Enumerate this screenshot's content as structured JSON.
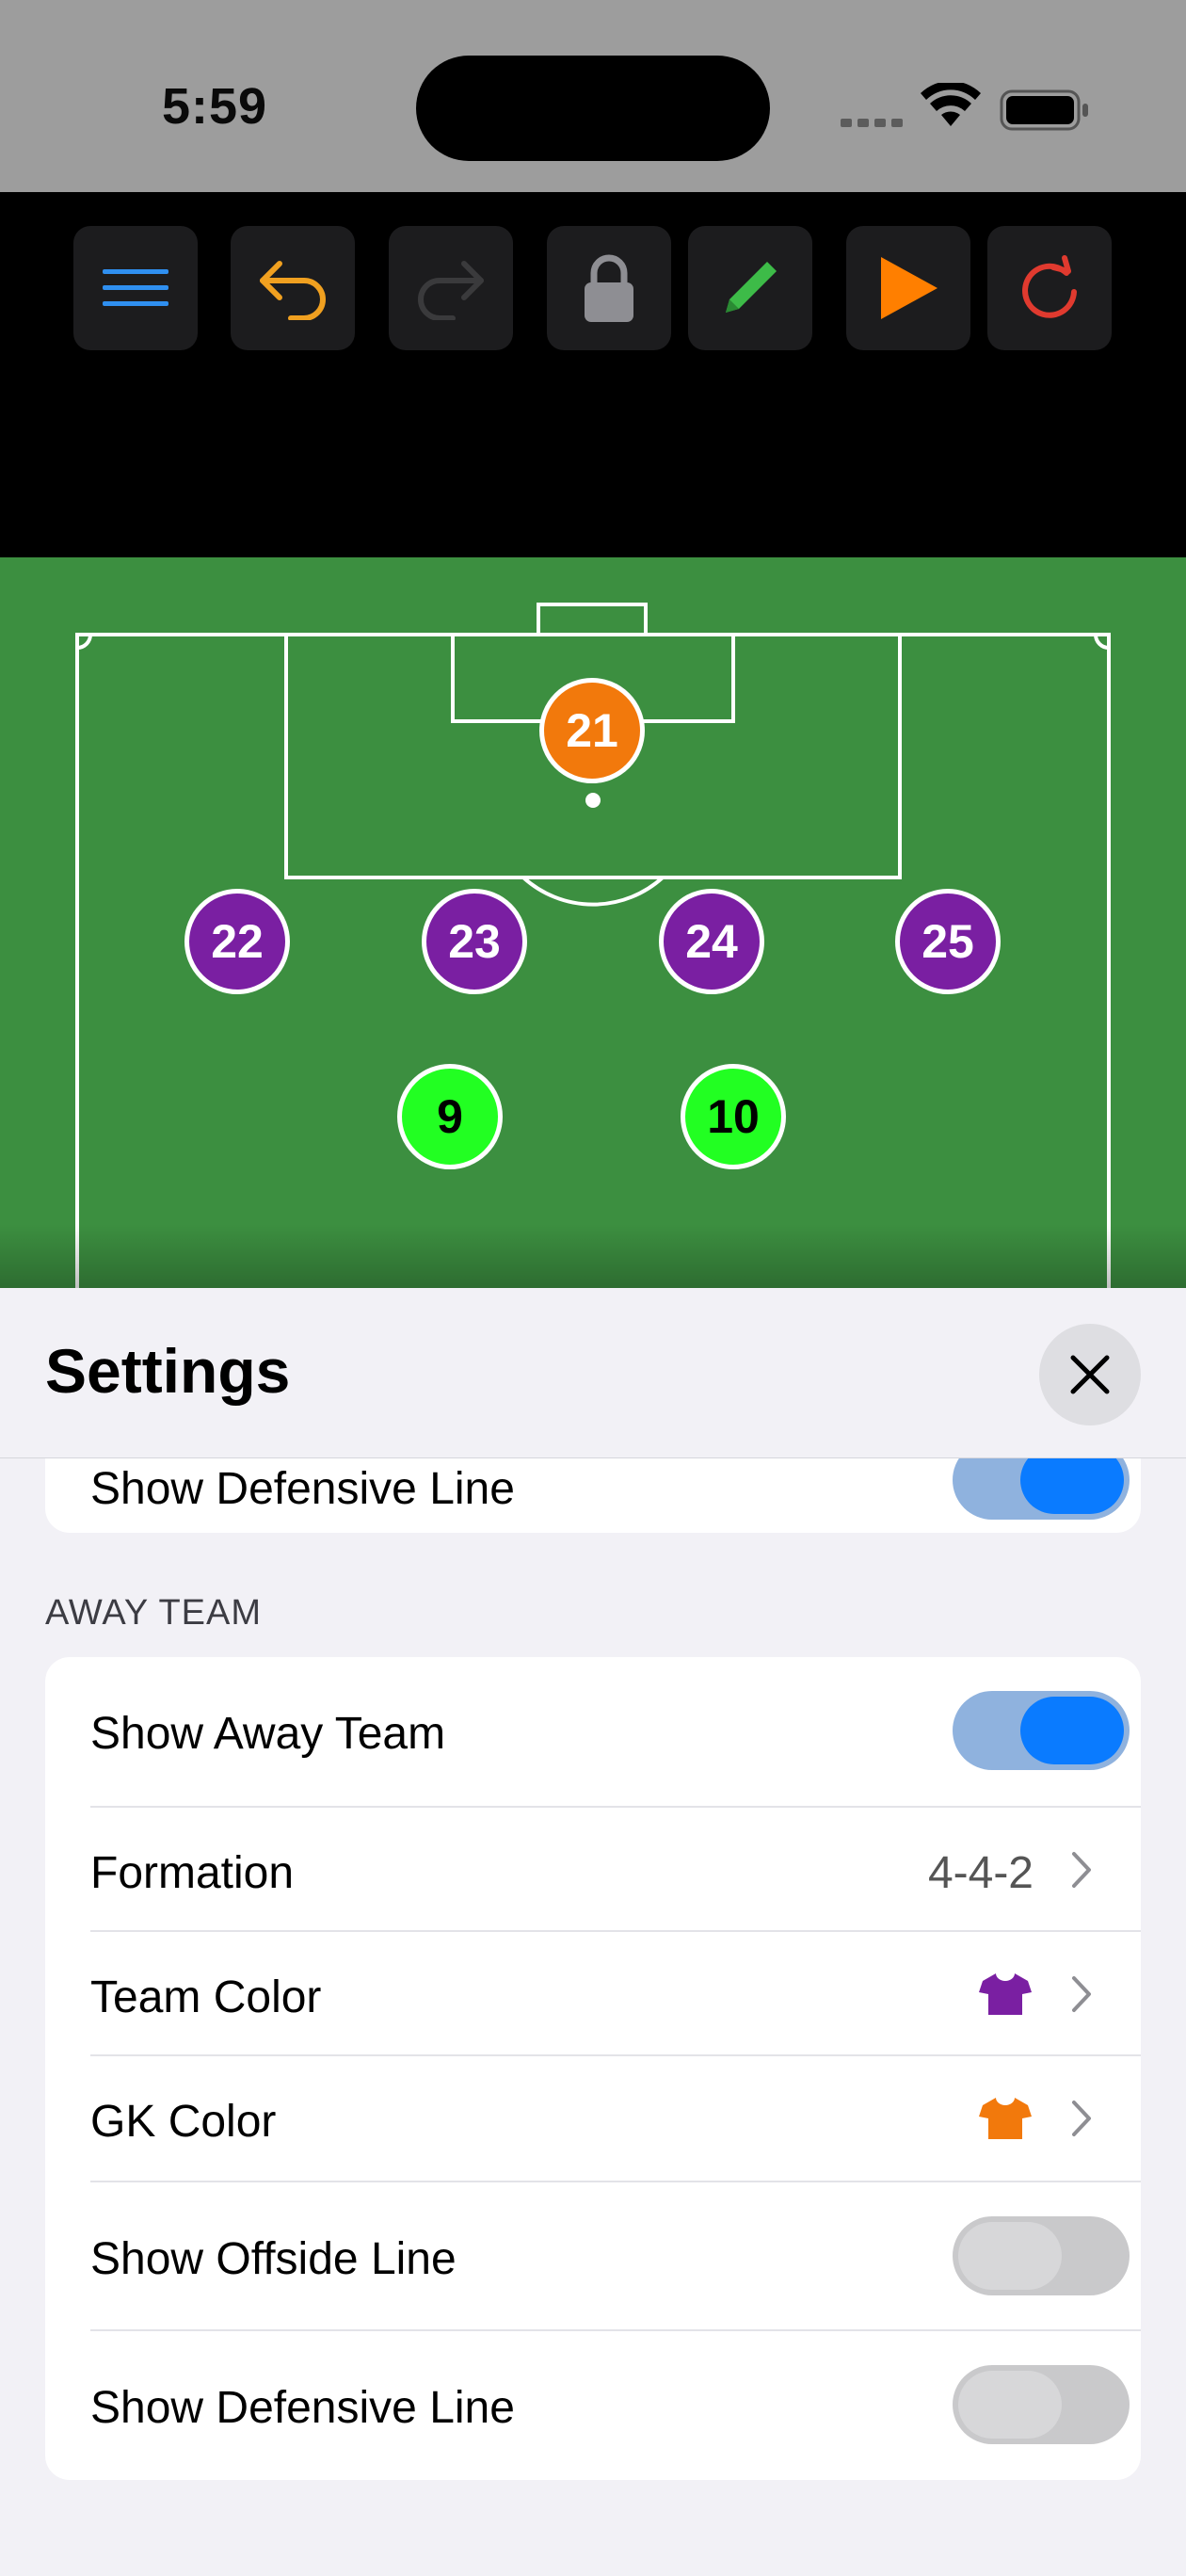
{
  "status_bar": {
    "time": "5:59"
  },
  "toolbar": {
    "buttons": [
      {
        "name": "menu-button",
        "icon": "hamburger-icon"
      },
      {
        "name": "undo-button",
        "icon": "undo-arrow-icon"
      },
      {
        "name": "redo-button",
        "icon": "redo-arrow-icon"
      },
      {
        "name": "lock-button",
        "icon": "lock-icon"
      },
      {
        "name": "draw-button",
        "icon": "pencil-icon"
      },
      {
        "name": "play-button",
        "icon": "play-icon"
      },
      {
        "name": "reset-button",
        "icon": "refresh-icon"
      }
    ],
    "colors": {
      "menu": "#2f8ff0",
      "undo": "#f0a020",
      "redo": "#3a3a3c",
      "lock": "#8e8e93",
      "draw": "#3dbb48",
      "play": "#ff7f00",
      "reset": "#e03a2f"
    }
  },
  "pitch": {
    "color": "#3c8f40",
    "players": [
      {
        "number": "21",
        "role": "gk"
      },
      {
        "number": "22",
        "role": "away"
      },
      {
        "number": "23",
        "role": "away"
      },
      {
        "number": "24",
        "role": "away"
      },
      {
        "number": "25",
        "role": "away"
      },
      {
        "number": "9",
        "role": "home"
      },
      {
        "number": "10",
        "role": "home"
      }
    ]
  },
  "settings": {
    "title": "Settings",
    "close_icon": "close-icon",
    "partial_row": {
      "label": "Show Defensive Line",
      "toggle": true
    },
    "away_team": {
      "header": "AWAY TEAM",
      "show_away_team": {
        "label": "Show Away Team",
        "toggle": true
      },
      "formation": {
        "label": "Formation",
        "value": "4-4-2"
      },
      "team_color": {
        "label": "Team Color",
        "color": "#7a1fa2",
        "icon": "shirt-icon"
      },
      "gk_color": {
        "label": "GK Color",
        "color": "#f2790c",
        "icon": "shirt-icon"
      },
      "show_offside_line": {
        "label": "Show Offside Line",
        "toggle": false
      },
      "show_defensive_line": {
        "label": "Show Defensive Line",
        "toggle": false
      }
    }
  }
}
